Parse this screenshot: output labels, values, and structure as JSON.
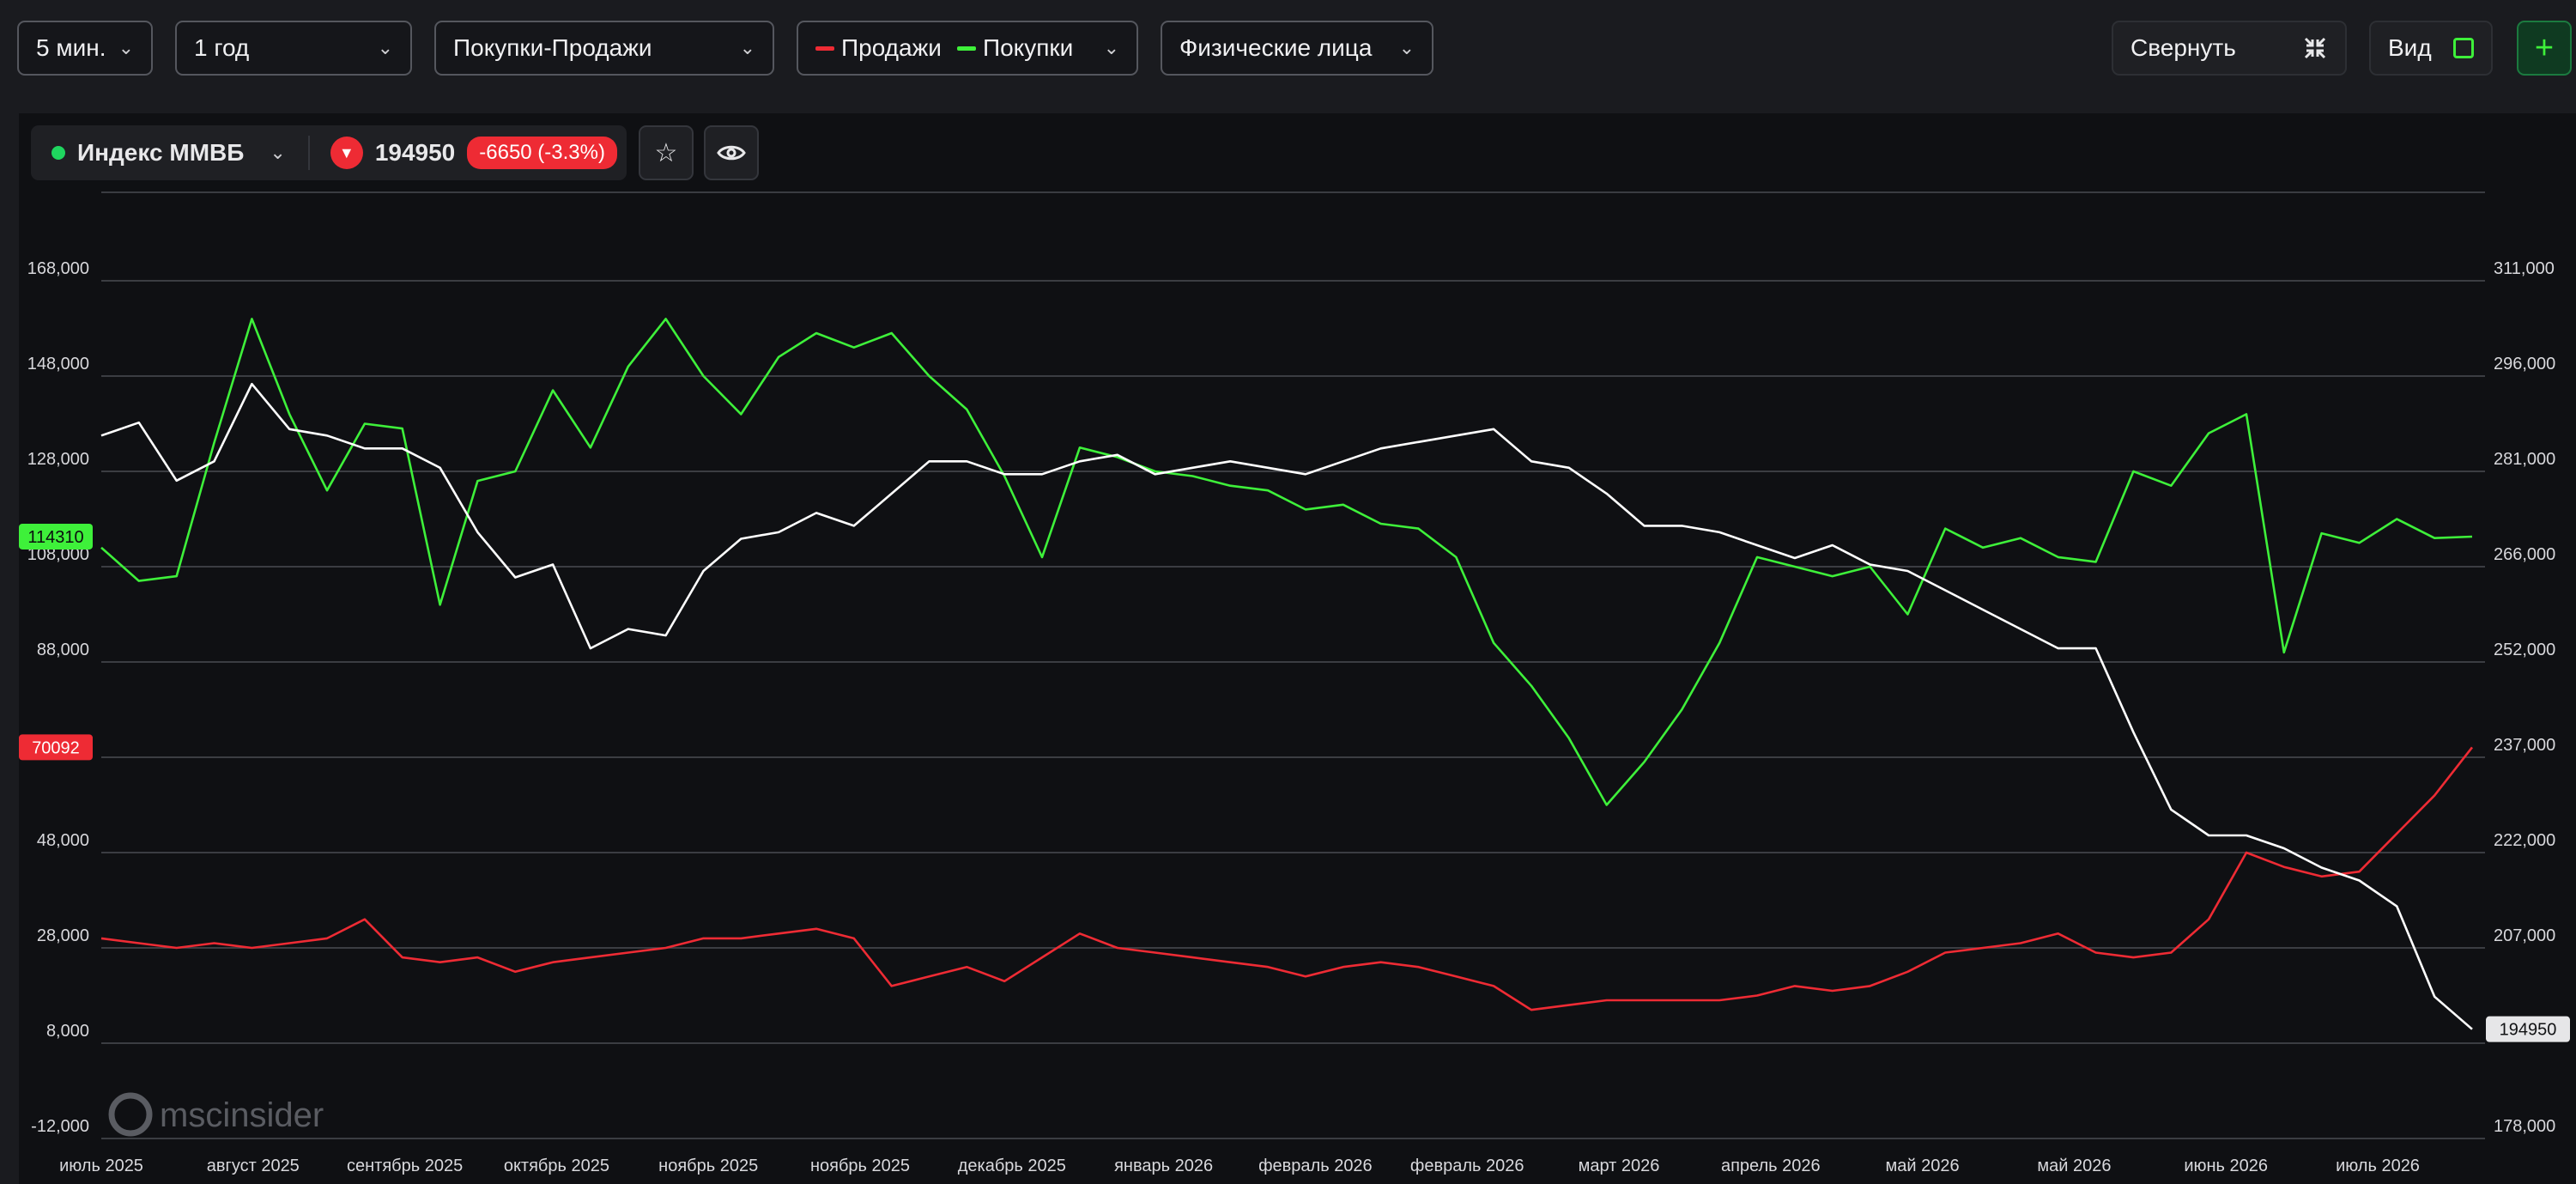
{
  "toolbar": {
    "interval": "5 мин.",
    "period": "1 год",
    "mode": "Покупки-Продажи",
    "legend": [
      {
        "label": "Продажи",
        "color": "#ee2b34"
      },
      {
        "label": "Покупки",
        "color": "#3ef03a"
      }
    ],
    "investor_type": "Физические лица",
    "collapse_label": "Свернуть",
    "view_label": "Вид",
    "add_label": "+"
  },
  "ticker": {
    "name": "Индекс ММВБ",
    "price": "194950",
    "change": "-6650 (-3.3%)"
  },
  "watermark": "mscinsider",
  "chart_data": {
    "type": "line",
    "x_labels": [
      "июль 2025",
      "август 2025",
      "сентябрь 2025",
      "октябрь 2025",
      "ноябрь 2025",
      "ноябрь 2025",
      "декабрь 2025",
      "январь 2026",
      "февраль 2026",
      "февраль 2026",
      "март 2026",
      "апрель 2026",
      "май 2026",
      "май 2026",
      "июнь 2026",
      "июль 2026"
    ],
    "left_axis": {
      "ticks": [
        "168,000",
        "148,000",
        "128,000",
        "108,000",
        "88,000",
        "68,000",
        "48,000",
        "28,000",
        "8,000",
        "-12,000"
      ],
      "range": [
        -12000,
        168000
      ]
    },
    "right_axis": {
      "ticks": [
        "311,000",
        "296,000",
        "281,000",
        "266,000",
        "252,000",
        "237,000",
        "222,000",
        "207,000",
        "194950",
        "178,000"
      ],
      "range": [
        178000,
        311000
      ]
    },
    "last_values": {
      "buys": "114310",
      "sales": "70092",
      "index": "194950"
    },
    "series": [
      {
        "name": "Покупки",
        "axis": "left",
        "color": "#3ef03a",
        "values": [
          112000,
          105000,
          106000,
          134000,
          160000,
          140000,
          124000,
          138000,
          137000,
          100000,
          126000,
          128000,
          145000,
          133000,
          150000,
          160000,
          148000,
          140000,
          152000,
          157000,
          154000,
          157000,
          148000,
          141000,
          127000,
          110000,
          133000,
          131000,
          128000,
          127000,
          125000,
          124000,
          120000,
          121000,
          117000,
          116000,
          110000,
          92000,
          83000,
          72000,
          58000,
          67000,
          78000,
          92000,
          110000,
          108000,
          106000,
          108000,
          98000,
          116000,
          112000,
          114000,
          110000,
          109000,
          128000,
          125000,
          136000,
          140000,
          90000,
          115000,
          113000,
          118000,
          114000,
          114310
        ]
      },
      {
        "name": "Продажи",
        "axis": "left",
        "color": "#ee2b34",
        "values": [
          30000,
          29000,
          28000,
          29000,
          28000,
          29000,
          30000,
          34000,
          26000,
          25000,
          26000,
          23000,
          25000,
          26000,
          27000,
          28000,
          30000,
          30000,
          31000,
          32000,
          30000,
          20000,
          22000,
          24000,
          21000,
          26000,
          31000,
          28000,
          27000,
          26000,
          25000,
          24000,
          22000,
          24000,
          25000,
          24000,
          22000,
          20000,
          15000,
          16000,
          17000,
          17000,
          17000,
          17000,
          18000,
          20000,
          19000,
          20000,
          23000,
          27000,
          28000,
          29000,
          31000,
          27000,
          26000,
          27000,
          34000,
          48000,
          45000,
          43000,
          44000,
          52000,
          60000,
          70092
        ]
      },
      {
        "name": "Индекс ММВБ",
        "axis": "right",
        "color": "#ffffff",
        "values": [
          287000,
          289000,
          280000,
          283000,
          295000,
          288000,
          287000,
          285000,
          285000,
          282000,
          272000,
          265000,
          267000,
          254000,
          257000,
          256000,
          266000,
          271000,
          272000,
          275000,
          273000,
          278000,
          283000,
          283000,
          281000,
          281000,
          283000,
          284000,
          281000,
          282000,
          283000,
          282000,
          281000,
          283000,
          285000,
          286000,
          287000,
          288000,
          283000,
          282000,
          278000,
          273000,
          273000,
          272000,
          270000,
          268000,
          270000,
          267000,
          266000,
          263000,
          260000,
          257000,
          254000,
          254000,
          241000,
          229000,
          225000,
          225000,
          223000,
          220000,
          218000,
          214000,
          200000,
          194950
        ]
      }
    ]
  }
}
